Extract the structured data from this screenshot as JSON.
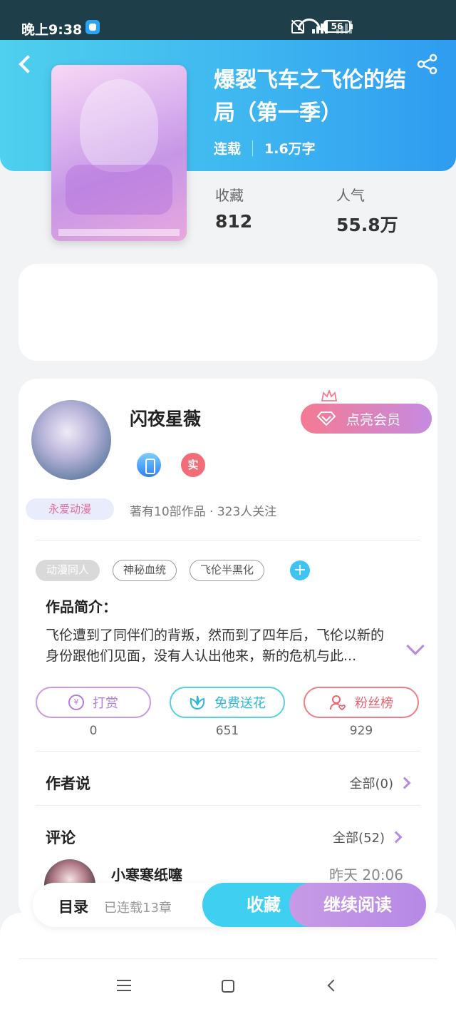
{
  "status_bar": {
    "time": "晚上9:38",
    "hd": "HD",
    "battery": "56"
  },
  "book": {
    "title": "爆裂飞车之飞伦的结局（第一季）",
    "status": "连载",
    "word_count": "1.6万字",
    "favorites_label": "收藏",
    "favorites_value": "812",
    "popularity_label": "人气",
    "popularity_value": "55.8万"
  },
  "author": {
    "name": "闪夜星薇",
    "vip_label": "点亮会员",
    "badge_real": "实",
    "fan_tag": "永爱动漫",
    "stats": "著有10部作品 · 323人关注"
  },
  "tags": [
    "动漫同人",
    "神秘血统",
    "飞伦半黑化"
  ],
  "intro": {
    "heading": "作品简介：",
    "text": "飞伦遭到了同伴们的背叛，然而到了四年后，飞伦以新的身份跟他们见面，没有人认出他来，新的危机与此..."
  },
  "actions": [
    {
      "label": "打赏",
      "count": "0",
      "icon": "yen-icon"
    },
    {
      "label": "免费送花",
      "count": "651",
      "icon": "flower-icon"
    },
    {
      "label": "粉丝榜",
      "count": "929",
      "icon": "fans-icon"
    }
  ],
  "author_says": {
    "title": "作者说",
    "more": "全部(0)"
  },
  "comments": {
    "title": "评论",
    "more": "全部(52)",
    "first": {
      "user": "小寒寒纸噻",
      "time": "昨天 20:06"
    }
  },
  "bottom_bar": {
    "toc": "目录",
    "toc_sub": "已连载13章",
    "favorite": "收藏",
    "continue": "继续阅读"
  },
  "colors": {
    "header": "#3eb6f0",
    "accent_purple": "#b689e6",
    "accent_cyan": "#3fcff0"
  }
}
